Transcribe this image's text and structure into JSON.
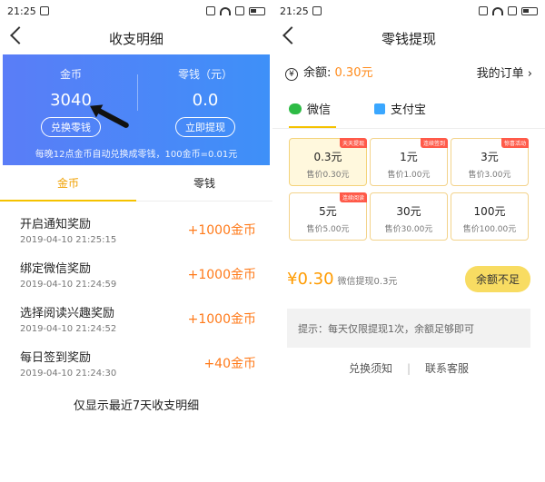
{
  "left": {
    "status": {
      "time": "21:25"
    },
    "header": {
      "title": "收支明细"
    },
    "summary": {
      "coins_label": "金币",
      "coins_value": "3040",
      "exchange_button": "兑换零钱",
      "change_label": "零钱（元）",
      "change_value": "0.0",
      "withdraw_button": "立即提现",
      "note": "每晚12点金币自动兑换成零钱，100金币=0.01元"
    },
    "tabs": [
      "金币",
      "零钱"
    ],
    "records": [
      {
        "title": "开启通知奖励",
        "time": "2019-04-10 21:25:15",
        "amount": "+1000金币"
      },
      {
        "title": "绑定微信奖励",
        "time": "2019-04-10 21:24:59",
        "amount": "+1000金币"
      },
      {
        "title": "选择阅读兴趣奖励",
        "time": "2019-04-10 21:24:52",
        "amount": "+1000金币"
      },
      {
        "title": "每日签到奖励",
        "time": "2019-04-10 21:24:30",
        "amount": "+40金币"
      }
    ],
    "footer": "仅显示最近7天收支明细"
  },
  "right": {
    "status": {
      "time": "21:25"
    },
    "header": {
      "title": "零钱提现"
    },
    "balance": {
      "label": "余额:",
      "value": "0.30元",
      "orders": "我的订单"
    },
    "pay_methods": [
      "微信",
      "支付宝"
    ],
    "options": [
      {
        "price": "0.3元",
        "sale": "售价0.30元",
        "tag": "天天提现",
        "selected": true
      },
      {
        "price": "1元",
        "sale": "售价1.00元",
        "tag": "连续签到",
        "selected": false
      },
      {
        "price": "3元",
        "sale": "售价3.00元",
        "tag": "惊喜活动",
        "selected": false
      },
      {
        "price": "5元",
        "sale": "售价5.00元",
        "tag": "连续阅读",
        "selected": false
      },
      {
        "price": "30元",
        "sale": "售价30.00元",
        "tag": "",
        "selected": false
      },
      {
        "price": "100元",
        "sale": "售价100.00元",
        "tag": "",
        "selected": false
      }
    ],
    "selected_price": "¥0.30",
    "selected_desc": "微信提现0.3元",
    "insufficient": "余额不足",
    "tip": "提示：每天仅限提现1次，余额足够即可",
    "links": [
      "兑换须知",
      "联系客服"
    ]
  }
}
